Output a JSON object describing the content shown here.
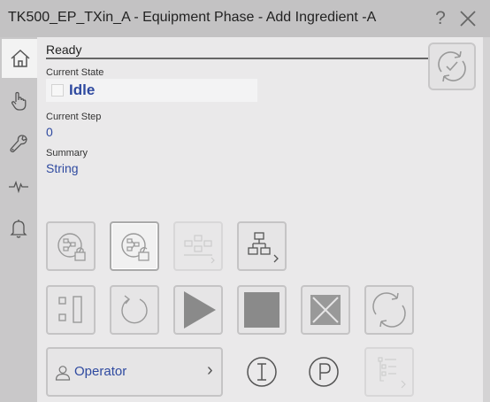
{
  "window": {
    "title": "TK500_EP_TXin_A - Equipment Phase - Add Ingredient -A",
    "help_glyph": "?"
  },
  "nav": {
    "tabs": [
      {
        "icon": "home-icon",
        "active": true
      },
      {
        "icon": "hand-pointer-icon",
        "active": false
      },
      {
        "icon": "wrench-icon",
        "active": false
      },
      {
        "icon": "pulse-icon",
        "active": false
      },
      {
        "icon": "bell-icon",
        "active": false
      }
    ]
  },
  "status": {
    "text": "Ready"
  },
  "fields": {
    "current_state_label": "Current State",
    "current_state_value": "Idle",
    "current_step_label": "Current Step",
    "current_step_value": "0",
    "summary_label": "Summary",
    "summary_value": "String"
  },
  "operator": {
    "label": "Operator",
    "chevron": "›"
  },
  "colors": {
    "accent_text": "#2f4aa0",
    "title_bar": "#c3c2c3",
    "rail": "#c9c8c9",
    "panel": "#eae9ea"
  }
}
